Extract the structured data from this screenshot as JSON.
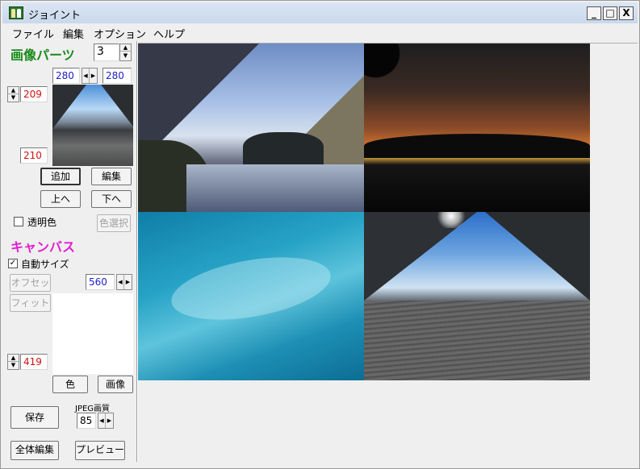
{
  "window": {
    "title": "ジョイント",
    "controls": [
      "_",
      "□",
      "X"
    ]
  },
  "menu": [
    "ファイル",
    "編集",
    "オプション",
    "ヘルプ"
  ],
  "parts": {
    "title": "画像パーツ",
    "count": "3",
    "width_left": "280",
    "width_right": "280",
    "y_offset": "209",
    "height": "210",
    "add_label": "追加",
    "edit_label": "編集",
    "up_label": "上へ",
    "down_label": "下へ",
    "transparent_label": "透明色",
    "transparent_checked": false,
    "color_select_label": "色選択"
  },
  "canvas": {
    "title": "キャンバス",
    "autosize_label": "自動サイズ",
    "autosize_checked": true,
    "offset_label": "オフセット",
    "fit_label": "フィット",
    "width": "560",
    "height": "419",
    "color_label": "色",
    "image_label": "画像"
  },
  "footer": {
    "save_label": "保存",
    "jpeg_label": "JPEG画質",
    "jpeg_quality": "85",
    "edit_all_label": "全体編集",
    "preview_label": "プレビュー"
  },
  "colors": {
    "title_green": "#1a8a1a",
    "title_magenta": "#e020d0",
    "number_blue": "#2020c8",
    "number_red": "#d01010"
  },
  "icons": [
    "app-icon",
    "spin-up-icon",
    "spin-down-icon",
    "spin-left-icon",
    "spin-right-icon",
    "checkmark-icon"
  ]
}
